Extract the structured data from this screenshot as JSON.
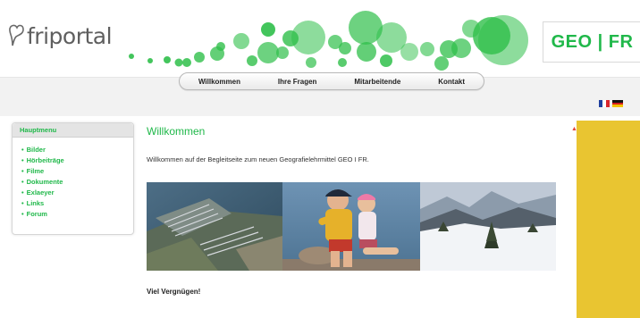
{
  "header": {
    "logo_text": "friportal",
    "product_badge": "GEO | FR"
  },
  "nav": {
    "items": [
      "Willkommen",
      "Ihre Fragen",
      "Mitarbeitende",
      "Kontakt"
    ]
  },
  "languages": [
    "fr",
    "de"
  ],
  "sidebar": {
    "title": "Hauptmenu",
    "items": [
      "Bilder",
      "Hörbeiträge",
      "Filme",
      "Dokumente",
      "Exlaeyer",
      "Links",
      "Forum"
    ]
  },
  "main": {
    "title": "Willkommen",
    "intro": "Willkommen auf der Begleitseite zum neuen Geografielehrmittel GEO I FR.",
    "photos": [
      "harbor-aerial-photo",
      "children-photo",
      "winter-landscape-photo"
    ],
    "closing": "Viel Vergnügen!"
  },
  "colors": {
    "accent": "#20b84a",
    "panel_yellow": "#e9c531"
  }
}
